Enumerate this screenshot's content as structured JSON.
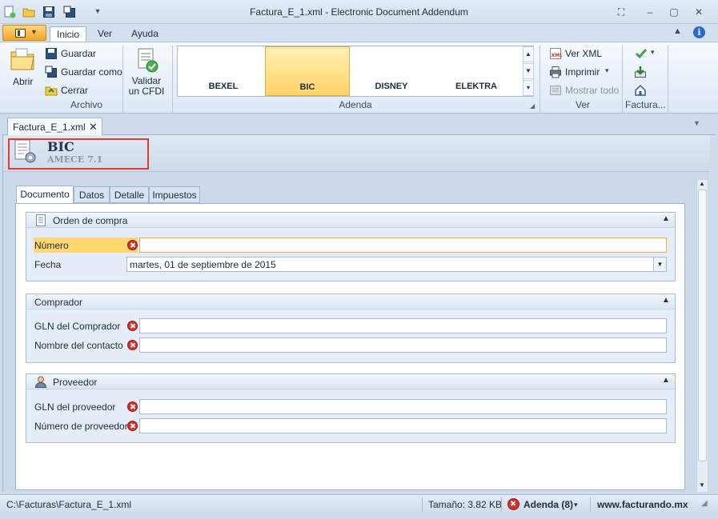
{
  "window": {
    "title": "Factura_E_1.xml - Electronic Document Addendum"
  },
  "ribbon_tabs": [
    {
      "label": "Inicio"
    },
    {
      "label": "Ver"
    },
    {
      "label": "Ayuda"
    }
  ],
  "ribbon": {
    "archivo": {
      "abrir": "Abrir",
      "guardar": "Guardar",
      "guardar_como": "Guardar como",
      "cerrar": "Cerrar",
      "label": "Archivo"
    },
    "validar": "Validar\nun CFDI",
    "adenda": {
      "items": [
        "BEXEL",
        "BIC",
        "DISNEY",
        "ELEKTRA"
      ],
      "selected": "BIC",
      "label": "Adenda"
    },
    "ver": {
      "ver_xml": "Ver XML",
      "imprimir": "Imprimir",
      "mostrar_todo": "Mostrar todo",
      "label": "Ver"
    },
    "factura": {
      "label": "Factura..."
    }
  },
  "doc_tab": {
    "label": "Factura_E_1.xml"
  },
  "document": {
    "title": "BIC",
    "subtitle": "AMECE 7.1",
    "tabs": [
      "Documento",
      "Datos",
      "Detalle",
      "Impuestos"
    ],
    "groups": {
      "orden": {
        "title": "Orden de compra",
        "numero_label": "Número",
        "fecha_label": "Fecha",
        "fecha_value": "martes, 01 de septiembre de 2015"
      },
      "comprador": {
        "title": "Comprador",
        "gln_label": "GLN del Comprador",
        "contacto_label": "Nombre del contacto"
      },
      "proveedor": {
        "title": "Proveedor",
        "gln_label": "GLN del proveedor",
        "numero_label": "Número de proveedor"
      }
    }
  },
  "status": {
    "path": "C:\\Facturas\\Factura_E_1.xml",
    "size": "Tamaño: 3.82 KB",
    "adenda": "Adenda (8)",
    "website": "www.facturando.mx"
  },
  "colors": {
    "selected_highlight": "#ffd870",
    "error": "#d0322a",
    "focus_outline": "#e53935"
  }
}
